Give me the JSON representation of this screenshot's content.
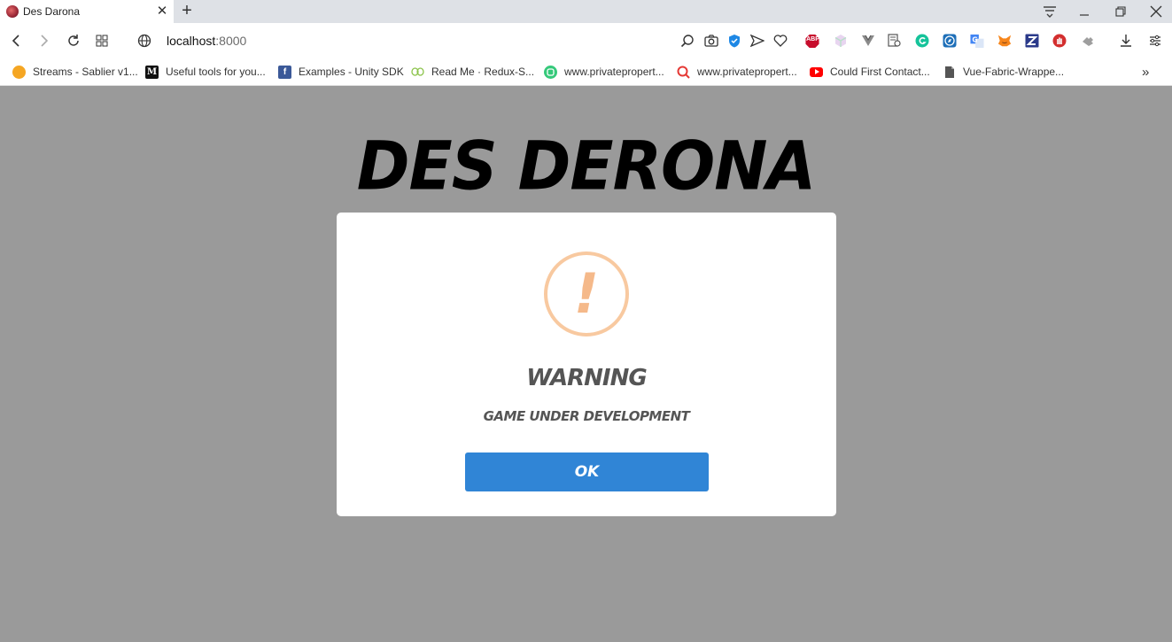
{
  "browser": {
    "tab": {
      "title": "Des Darona",
      "close_glyph": "✕"
    },
    "new_tab_glyph": "+",
    "window_controls": [
      "tab-search-icon",
      "minimize-icon",
      "restore-icon",
      "close-icon"
    ],
    "url": {
      "host": "localhost",
      "port": ":8000"
    },
    "extensions": [
      "zoom-icon",
      "camera-icon",
      "shield-icon",
      "send-icon",
      "heart-icon",
      "adblock-icon",
      "cube-icon",
      "vue-devtools-icon",
      "page-scan-icon",
      "grammarly-icon",
      "compass-icon",
      "translate-icon",
      "metamask-icon",
      "zotero-icon",
      "stop-hand-icon",
      "puzzle-icon",
      "download-icon",
      "settings-icon"
    ],
    "adblock_label": "ABP",
    "bookmarks": [
      {
        "label": "Streams - Sablier v1...",
        "icon": "sablier-icon",
        "color": "#f5a623"
      },
      {
        "label": "Useful tools for you...",
        "icon": "medium-icon",
        "color": "#111111",
        "glyph": "M"
      },
      {
        "label": "Examples - Unity SDK",
        "icon": "facebook-icon",
        "color": "#3b5998",
        "glyph": "f"
      },
      {
        "label": "Read Me · Redux-S...",
        "icon": "redux-saga-icon",
        "color": "#8bc34a"
      },
      {
        "label": "www.privatepropert...",
        "icon": "privateproperty-icon",
        "color": "#35c97a"
      },
      {
        "label": "www.privatepropert...",
        "icon": "search-pin-icon",
        "color": "#e53935"
      },
      {
        "label": "Could First Contact...",
        "icon": "youtube-icon",
        "color": "#ff0000"
      },
      {
        "label": "Vue-Fabric-Wrappe...",
        "icon": "file-icon",
        "color": "#555555"
      }
    ],
    "more_bookmarks_glyph": "»"
  },
  "page": {
    "game_title": "DES DERONA",
    "modal": {
      "icon": "warning-icon",
      "icon_glyph": "!",
      "title": "WARNING",
      "text": "GAME UNDER DEVELOPMENT",
      "ok_label": "OK"
    }
  },
  "colors": {
    "page_background": "#9a9a9a",
    "ok_button": "#3085d6",
    "warning_ring": "#f8c9a0",
    "warning_mark": "#f5b98a"
  }
}
